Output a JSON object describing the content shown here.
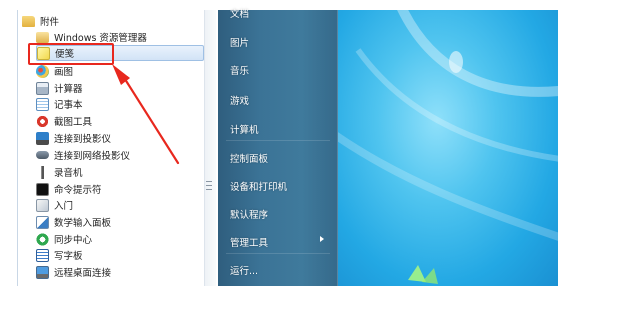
{
  "programs": {
    "folder_label": "附件",
    "items": [
      {
        "label": "Windows 资源管理器",
        "icon": "folder-explorer-icon"
      },
      {
        "label": "便笺",
        "icon": "sticky-notes-icon",
        "selected": true
      },
      {
        "label": "画图",
        "icon": "paint-icon"
      },
      {
        "label": "计算器",
        "icon": "calculator-icon"
      },
      {
        "label": "记事本",
        "icon": "notepad-icon"
      },
      {
        "label": "截图工具",
        "icon": "snipping-tool-icon"
      },
      {
        "label": "连接到投影仪",
        "icon": "projector-icon"
      },
      {
        "label": "连接到网络投影仪",
        "icon": "network-projector-icon"
      },
      {
        "label": "录音机",
        "icon": "microphone-icon"
      },
      {
        "label": "命令提示符",
        "icon": "command-prompt-icon"
      },
      {
        "label": "入门",
        "icon": "getting-started-icon"
      },
      {
        "label": "数学输入面板",
        "icon": "math-input-icon"
      },
      {
        "label": "同步中心",
        "icon": "sync-center-icon"
      },
      {
        "label": "写字板",
        "icon": "wordpad-icon"
      },
      {
        "label": "远程桌面连接",
        "icon": "remote-desktop-icon"
      }
    ]
  },
  "right_menu": {
    "items": [
      "文档",
      "图片",
      "音乐",
      "游戏",
      "计算机",
      "控制面板",
      "设备和打印机",
      "默认程序",
      "管理工具",
      "运行..."
    ]
  },
  "colors": {
    "highlight": "#e8281e",
    "menu_bg": "#3b7396",
    "desktop": "#23a8e4"
  }
}
